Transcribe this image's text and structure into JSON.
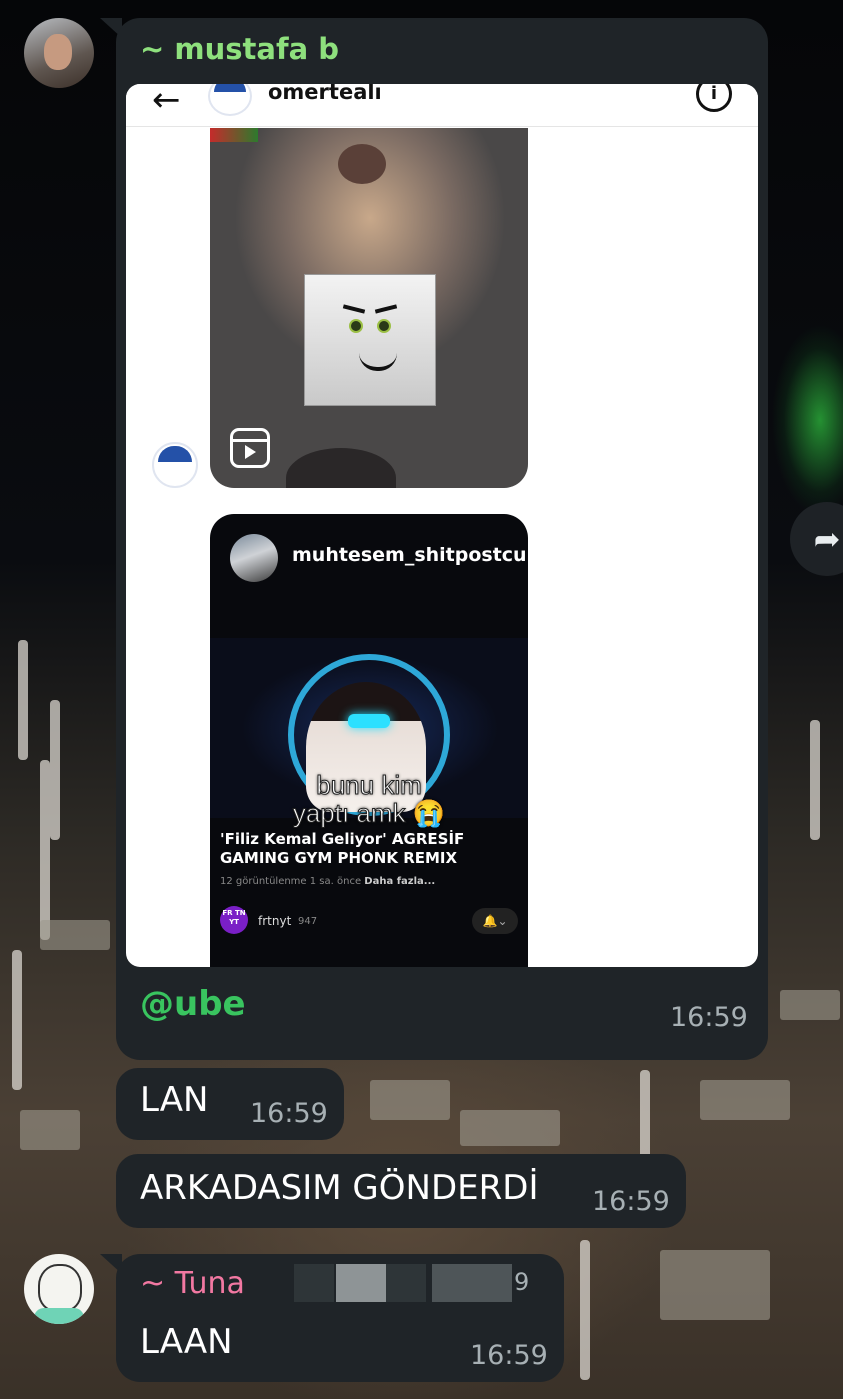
{
  "messages": {
    "first_sender": {
      "name": "~ mustafa b",
      "screenshot": {
        "username": "omertealı",
        "info_icon": "info-icon",
        "back_icon": "arrow-left-icon",
        "reel_icon": "reels-icon",
        "reel2": {
          "username": "muhtesem_shitpostcu",
          "meme_line1": "bunu kim",
          "meme_line2": "yaptı amk 😭",
          "video_title": "'Filiz Kemal Geliyor' AGRESİF GAMING GYM PHONK REMIX",
          "video_meta": "12 görüntülenme 1 sa. önce",
          "video_more": "Daha fazla...",
          "channel_avatar_text": "FR TN YT",
          "channel_name": "frtnyt",
          "channel_subs": "947"
        }
      },
      "caption": "@ube",
      "time": "16:59"
    },
    "reply1": {
      "text": "LAN",
      "time": "16:59"
    },
    "reply2": {
      "text": "ARKADASIM GÖNDERDİ",
      "time": "16:59"
    },
    "second_sender": {
      "name": "~ Tuna",
      "text": "LAAN",
      "time": "16:59",
      "partial_char": "9"
    }
  },
  "forward_icon": "forward-icon",
  "colors": {
    "bubble": "#1f2428",
    "mustafa_name": "#8ee07d",
    "tuna_name": "#f278a2",
    "mention": "#39c45f"
  }
}
